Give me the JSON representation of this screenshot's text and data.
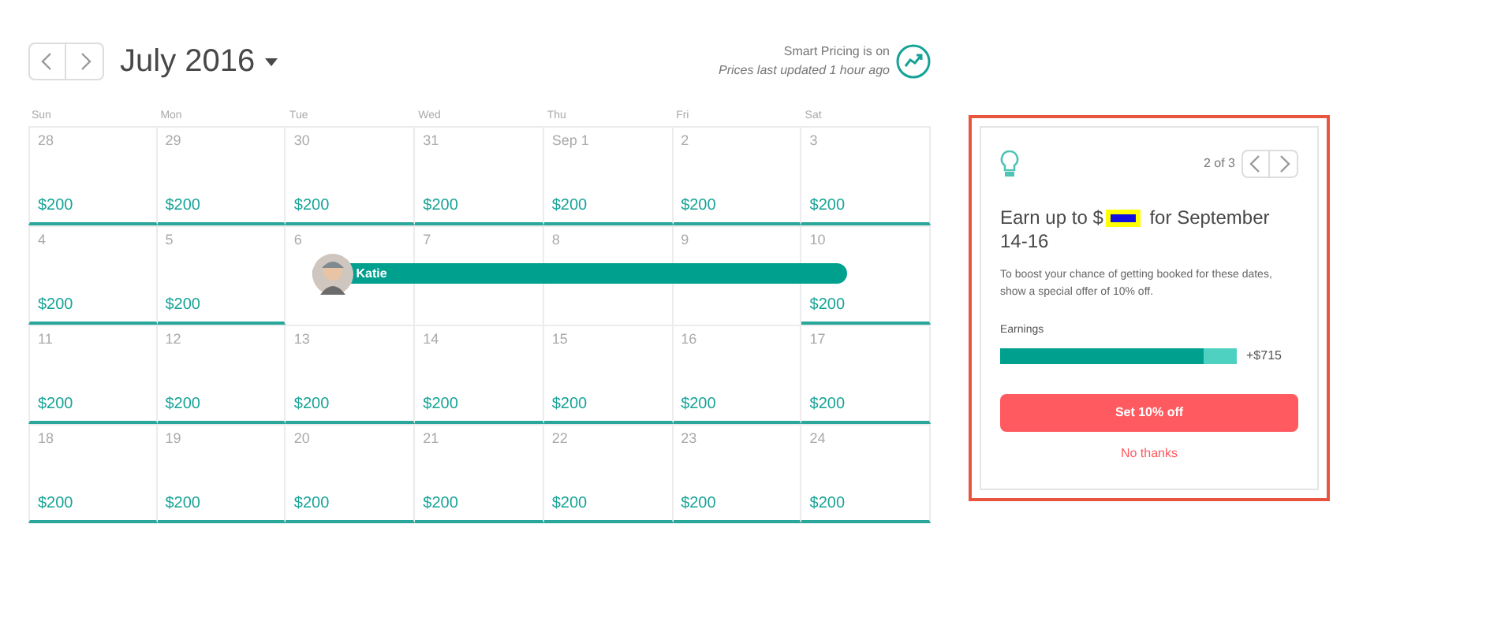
{
  "header": {
    "month": "July 2016",
    "pricing_status": "Smart Pricing is on",
    "pricing_updated": "Prices last updated 1 hour ago"
  },
  "weekdays": [
    "Sun",
    "Mon",
    "Tue",
    "Wed",
    "Thu",
    "Fri",
    "Sat"
  ],
  "weeks": [
    {
      "days": [
        {
          "date": "28",
          "price": "$200",
          "booked": false
        },
        {
          "date": "29",
          "price": "$200",
          "booked": false
        },
        {
          "date": "30",
          "price": "$200",
          "booked": false
        },
        {
          "date": "31",
          "price": "$200",
          "booked": false
        },
        {
          "date": "Sep 1",
          "price": "$200",
          "booked": false
        },
        {
          "date": "2",
          "price": "$200",
          "booked": false
        },
        {
          "date": "3",
          "price": "$200",
          "booked": false
        }
      ]
    },
    {
      "booking": {
        "guest": "Katie"
      },
      "days": [
        {
          "date": "4",
          "price": "$200",
          "booked": false
        },
        {
          "date": "5",
          "price": "$200",
          "booked": false
        },
        {
          "date": "6",
          "booked": true
        },
        {
          "date": "7",
          "booked": true
        },
        {
          "date": "8",
          "booked": true
        },
        {
          "date": "9",
          "booked": true
        },
        {
          "date": "10",
          "price": "$200",
          "booked": false
        }
      ]
    },
    {
      "days": [
        {
          "date": "11",
          "price": "$200",
          "booked": false
        },
        {
          "date": "12",
          "price": "$200",
          "booked": false
        },
        {
          "date": "13",
          "price": "$200",
          "booked": false
        },
        {
          "date": "14",
          "price": "$200",
          "booked": false
        },
        {
          "date": "15",
          "price": "$200",
          "booked": false
        },
        {
          "date": "16",
          "price": "$200",
          "booked": false
        },
        {
          "date": "17",
          "price": "$200",
          "booked": false
        }
      ]
    },
    {
      "days": [
        {
          "date": "18",
          "price": "$200",
          "booked": false
        },
        {
          "date": "19",
          "price": "$200",
          "booked": false
        },
        {
          "date": "20",
          "price": "$200",
          "booked": false
        },
        {
          "date": "21",
          "price": "$200",
          "booked": false
        },
        {
          "date": "22",
          "price": "$200",
          "booked": false
        },
        {
          "date": "23",
          "price": "$200",
          "booked": false
        },
        {
          "date": "24",
          "price": "$200",
          "booked": false
        }
      ]
    }
  ],
  "tip": {
    "pager": "2 of 3",
    "title_start": "Earn up to $",
    "title_end": "for September 14-16",
    "body": "To boost your chance of getting booked for these dates, show a special offer of 10% off.",
    "earnings_label": "Earnings",
    "earnings": {
      "level": 0.86,
      "value": "+$715"
    },
    "primary_button": "Set 10% off",
    "secondary_button": "No thanks"
  }
}
